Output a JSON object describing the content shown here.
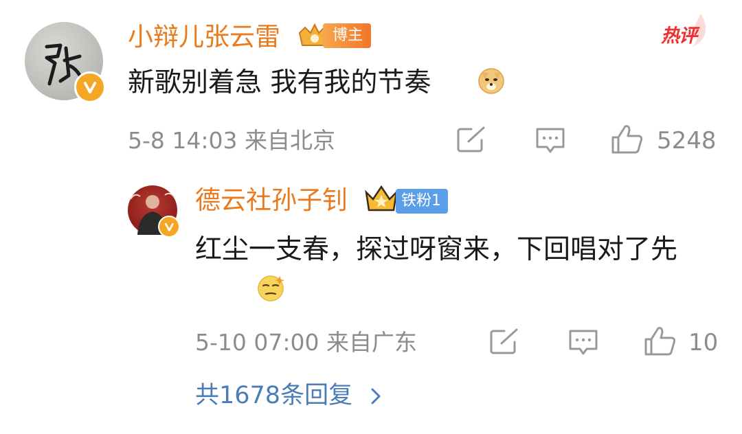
{
  "main_comment": {
    "username": "小辩儿张云雷",
    "badge": "博主",
    "hot_label": "热评",
    "text": "新歌别着急 我有我的节奏",
    "emoji": "doge-emoji",
    "timestamp": "5-8 14:03",
    "location": "来自北京",
    "like_count": "5248",
    "avatar_char": "張"
  },
  "reply": {
    "username": "德云社孙子钊",
    "fan_badge": "铁粉1",
    "text": "红尘一支春，探过呀窗来，下回唱对了先",
    "emoji": "smirk-emoji",
    "timestamp": "5-10 07:00",
    "location": "来自广东",
    "like_count": "10"
  },
  "reply_summary": {
    "label": "共1678条回复",
    "chevron": ">"
  },
  "colors": {
    "username": "#ea7a1c",
    "hot_label": "#f0302e",
    "link": "#4a7db8",
    "meta": "#8c8c8c",
    "verified_badge": "#f5a623",
    "fan_badge": "#5a9eea"
  }
}
